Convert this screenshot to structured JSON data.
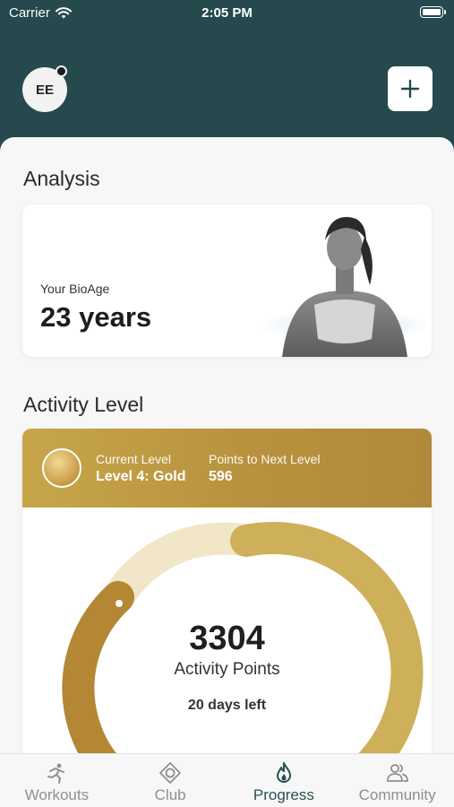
{
  "status_bar": {
    "carrier": "Carrier",
    "time": "2:05 PM"
  },
  "header": {
    "avatar_initials": "EE",
    "add_icon": "plus-icon"
  },
  "analysis": {
    "title": "Analysis",
    "bioage_label": "Your BioAge",
    "bioage_value": "23 years"
  },
  "activity": {
    "title": "Activity Level",
    "current_level_label": "Current Level",
    "current_level_value": "Level 4: Gold",
    "next_level_label": "Points to Next Level",
    "next_level_value": "596",
    "points": "3304",
    "points_label": "Activity Points",
    "days_left": "20 days left",
    "colors": {
      "gold": "#c9a64c",
      "gold_light": "#f1e7c8",
      "gold_dark": "#b38733"
    }
  },
  "tabs": [
    {
      "label": "Workouts",
      "icon": "runner-icon",
      "active": false
    },
    {
      "label": "Club",
      "icon": "club-icon",
      "active": false
    },
    {
      "label": "Progress",
      "icon": "flame-icon",
      "active": true
    },
    {
      "label": "Community",
      "icon": "people-icon",
      "active": false
    }
  ],
  "colors": {
    "header": "#25494d",
    "active_tab": "#2b4f52",
    "inactive_tab": "#8f8f8f"
  }
}
